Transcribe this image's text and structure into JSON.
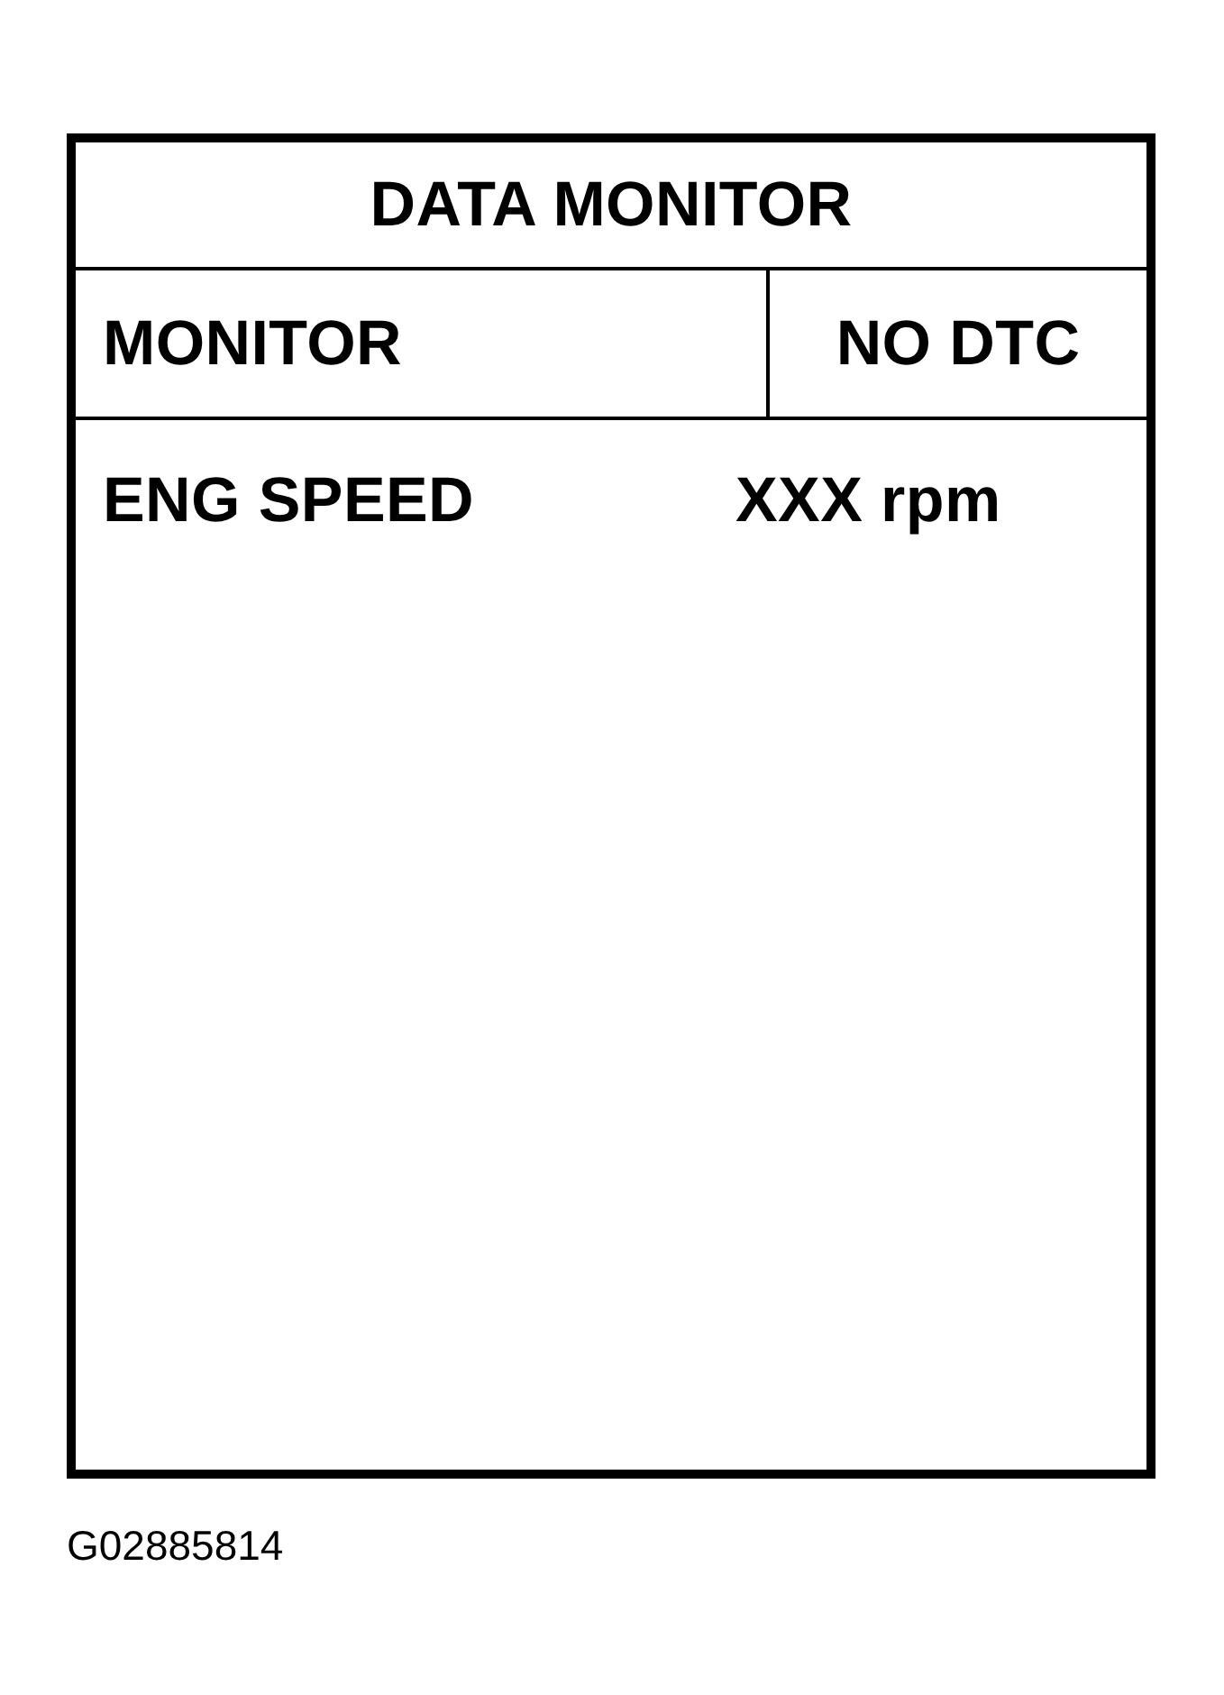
{
  "panel": {
    "title": "DATA MONITOR",
    "mode": "MONITOR",
    "status": "NO DTC",
    "readings": [
      {
        "label": "ENG SPEED",
        "value": "XXX rpm"
      }
    ]
  },
  "figure_code": "G02885814"
}
